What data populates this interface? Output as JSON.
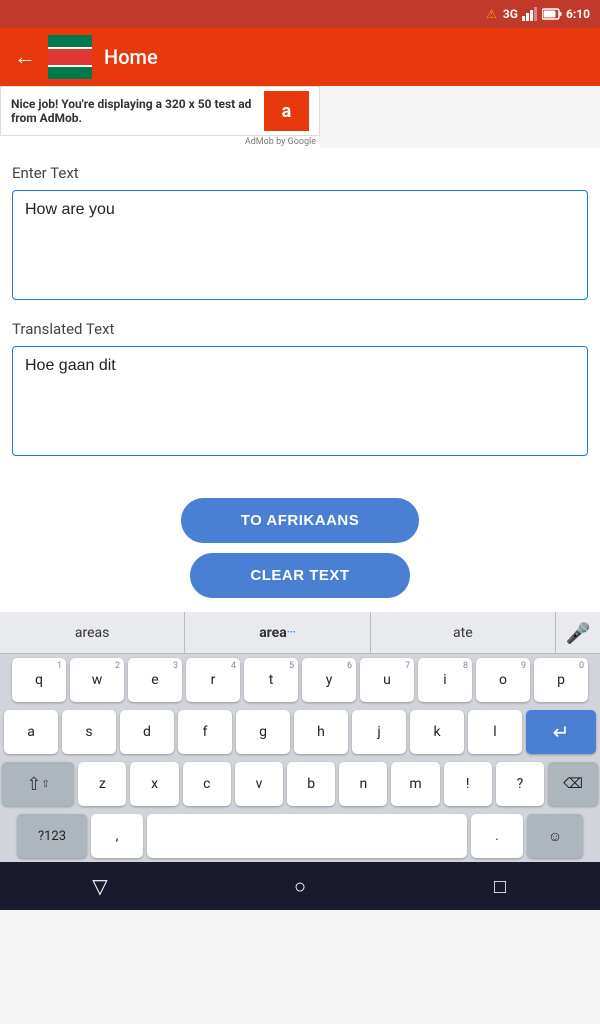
{
  "statusBar": {
    "signal": "3G",
    "battery": "6:10",
    "warnIcon": "⚠"
  },
  "appBar": {
    "title": "Home",
    "backLabel": "←"
  },
  "adBanner": {
    "boldText": "Nice job!",
    "bodyText": " You're displaying a 320 x 50 test ad from AdMob.",
    "logoLetter": "a",
    "byText": "AdMob by Google"
  },
  "enterTextLabel": "Enter Text",
  "inputText": "How are you",
  "translatedTextLabel": "Translated Text",
  "translatedText": "Hoe gaan dit",
  "buttons": {
    "toAfrikaans": "TO AFRIKAANS",
    "clearText": "CLEAR TEXT"
  },
  "keyboard": {
    "suggestions": [
      "areas",
      "area",
      "ate"
    ],
    "rows": [
      [
        "q",
        "w",
        "e",
        "r",
        "t",
        "y",
        "u",
        "i",
        "o",
        "p"
      ],
      [
        "a",
        "s",
        "d",
        "f",
        "g",
        "h",
        "j",
        "k",
        "l"
      ],
      [
        "z",
        "x",
        "c",
        "v",
        "b",
        "n",
        "m",
        "!",
        "?"
      ]
    ],
    "numbers": [
      "1",
      "2",
      "3",
      "4",
      "5",
      "6",
      "7",
      "8",
      "9",
      "0"
    ],
    "specialKeys": {
      "shift": "⇧",
      "backspace": "⌫",
      "enter": "↵",
      "space": "",
      "sym": "?123",
      "comma": ",",
      "period": "."
    }
  },
  "bottomNav": {
    "back": "▽",
    "home": "○",
    "recent": "□"
  }
}
